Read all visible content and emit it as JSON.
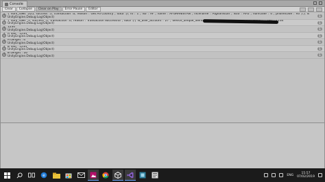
{
  "window": {
    "tab_label": "Console"
  },
  "toolbar": {
    "buttons": [
      "Clear",
      "Collapse",
      "Clear on Play",
      "Error Pause",
      "Editor"
    ]
  },
  "logs": [
    {
      "line1": "{\"num_rows\":225,\"success\":1,\"transaction\":0,\"reason\":\"Get All Country\",\"data\":[{\"id\":\"1\",\"iso\":\"AF\",\"name\":\"AFGHANISTAN\",\"nicename\":\"Afghanistan\",\"iso3\":\"AFG\",\"numcode\":\"4\",\"phonecode\":\"93\"},{\"id\":\"2\",\"iso\":\"AL\",\"name\":\"ALBANIA\"",
      "line2": "UnityEngine.Debug:Log(Object)",
      "count": "1"
    },
    {
      "line1": "{\"num_rows\":1,\"success\":1,\"transaction\":0,\"reason\":\"Transaction Successful\",\"data\":[{\"id_user_account\":\"27\",\"device_unique_identifier\":                                   fc5d6ba0e1c\",\"master_password\":\"\",\"pin\":\"1234\"",
      "line2": "UnityEngine.Debug:Log(Object)",
      "count": "1"
    },
    {
      "line1": "1234",
      "line2": "UnityEngine.Debug:Log(Object)",
      "count": "1"
    },
    {
      "line1": "A Text : 1234",
      "line2": "UnityEngine.Debug:Log(Object)",
      "count": "1"
    },
    {
      "line1": "A Lenght : 4",
      "line2": "UnityEngine.Debug:Log(Object)",
      "count": "1"
    },
    {
      "line1": "B Text : 1234",
      "line2": "UnityEngine.Debug:Log(Object)",
      "count": "1"
    },
    {
      "line1": "B Lenght : 16",
      "line2": "UnityEngine.Debug:Log(Object)",
      "count": "1"
    }
  ],
  "taskbar": {
    "apps": [
      "start-icon",
      "search-icon",
      "task-view-icon",
      "edge-icon",
      "file-explorer-icon",
      "store-icon",
      "mail-icon",
      "photos-icon",
      "chrome-icon",
      "unity-icon",
      "visual-studio-icon",
      "app-icon",
      "app-icon-2"
    ],
    "clock_time": "15:57",
    "clock_date": "07/02/2019",
    "language": "ENG"
  }
}
